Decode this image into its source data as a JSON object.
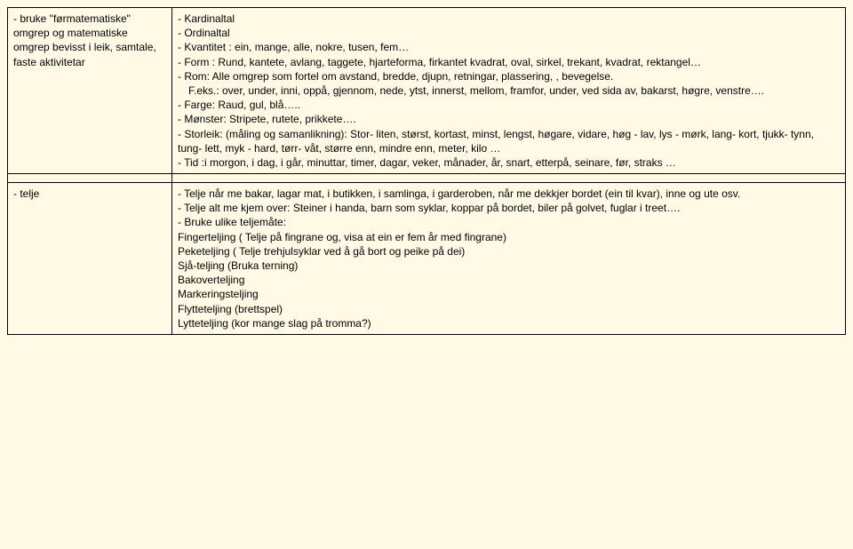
{
  "rows": [
    {
      "left": [
        "- bruke \"førmatematiske\" omgrep og matematiske omgrep bevisst i leik, samtale, faste aktivitetar"
      ],
      "right": [
        "- Kardinaltal",
        "- Ordinaltal",
        "- Kvantitet : ein, mange, alle, nokre, tusen, fem…",
        "- Form : Rund, kantete, avlang, taggete, hjarteforma, firkantet kvadrat, oval, sirkel, trekant, kvadrat, rektangel…",
        "- Rom: Alle omgrep som fortel om avstand, bredde, djupn, retningar, plassering, , bevegelse.",
        "  F.eks.: over, under, inni, oppå, gjennom, nede, ytst, innerst, mellom,  framfor, under, ved sida av, bakarst, høgre, venstre….",
        "- Farge: Raud, gul, blå…..",
        "- Mønster: Stripete, rutete, prikkete….",
        "- Storleik: (måling og samanlikning): Stor- liten, størst, kortast, minst, lengst, høgare, vidare, høg - lav, lys - mørk, lang- kort, tjukk- tynn, tung- lett, myk - hard, tørr- våt, større enn, mindre enn, meter, kilo …",
        "- Tid :i morgon, i dag, i går, minuttar, timer, dagar, veker, månader, år, snart, etterpå, seinare, før, straks …"
      ]
    },
    {
      "left": [],
      "right": []
    },
    {
      "left": [
        "- telje"
      ],
      "right": [
        "- Telje når me bakar, lagar mat, i butikken, i samlinga, i garderoben, når me dekkjer  bordet (ein til kvar), inne og ute osv.",
        "- Telje alt me kjem over: Steiner i handa, barn som syklar, koppar på bordet, biler på golvet, fuglar i treet….",
        "-  Bruke ulike teljemåte:",
        "Fingerteljing ( Telje  på fingrane og,  visa  at ein er fem år med fingrane)",
        "Peketeljing ( Telje  trehjulsyklar ved å gå bort og peike  på dei)",
        "Sjå-teljing (Bruka terning)",
        "Bakoverteljing",
        "Markeringsteljing",
        "Flytteteljing  (brettspel)",
        "Lytteteljing (kor mange slag på tromma?)"
      ]
    }
  ]
}
